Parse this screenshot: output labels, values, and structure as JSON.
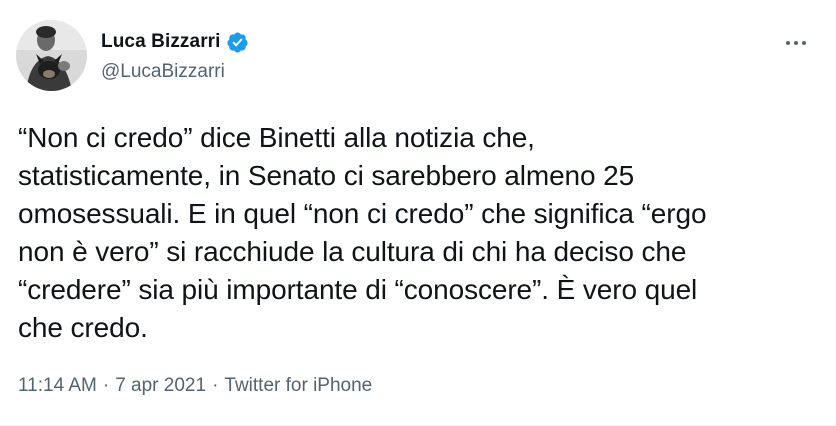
{
  "author": {
    "display_name": "Luca Bizzarri",
    "handle": "@LucaBizzarri",
    "verified": true,
    "avatar_icon": "avatar-photo"
  },
  "tweet": {
    "text": "“Non ci credo” dice Binetti alla notizia che,\nstatisticamente, in Senato ci sarebbero almeno 25\nomosessuali. E in quel “non ci credo” che significa “ergo\nnon è vero” si racchiude la cultura di chi ha deciso che\n“credere” sia più importante di “conoscere”.  È vero quel\nche credo.",
    "time": "11:14 AM",
    "separator": "·",
    "date": "7 apr 2021",
    "source": "Twitter for iPhone"
  },
  "icons": {
    "verified": "verified-badge-icon",
    "more": "more-options-icon"
  },
  "colors": {
    "text_primary": "#0f1419",
    "text_secondary": "#536471",
    "verified_blue": "#1d9bf0"
  }
}
